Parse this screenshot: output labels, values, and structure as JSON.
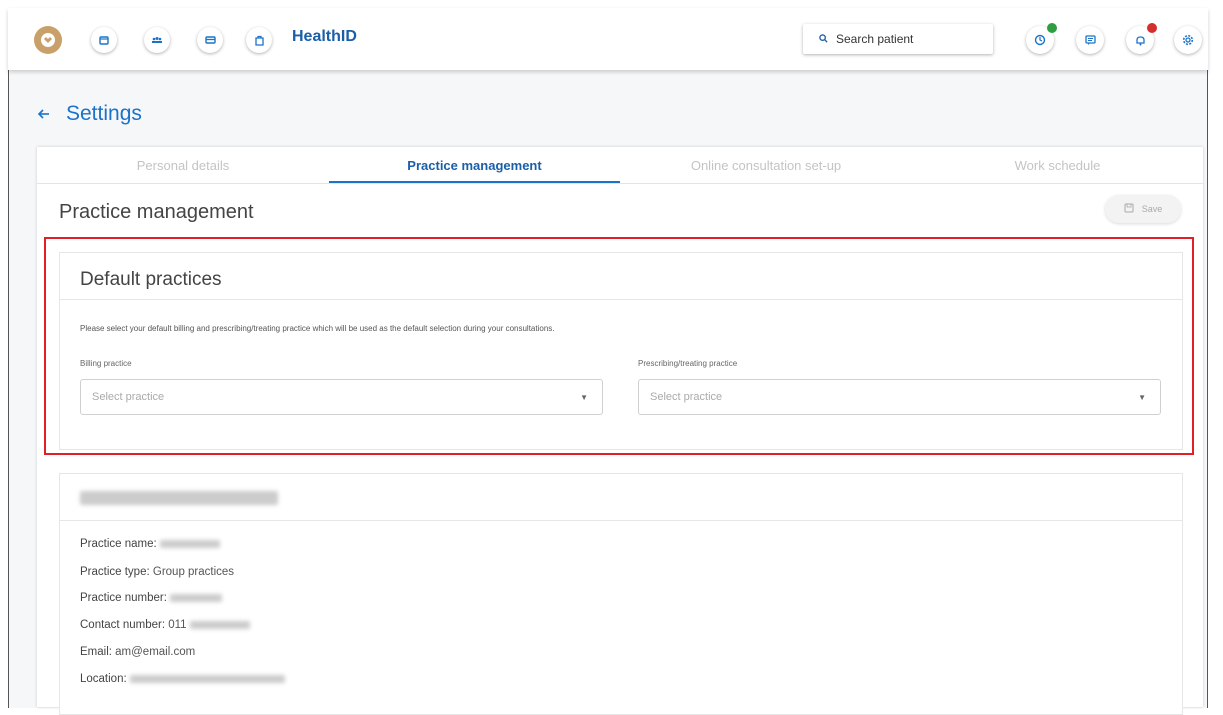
{
  "app": {
    "name": "HealthID"
  },
  "search": {
    "placeholder": "Search patient"
  },
  "page": {
    "title": "Settings"
  },
  "tabs": [
    {
      "label": "Personal details",
      "active": false
    },
    {
      "label": "Practice management",
      "active": true
    },
    {
      "label": "Online consultation set-up",
      "active": false
    },
    {
      "label": "Work schedule",
      "active": false
    }
  ],
  "section": {
    "title": "Practice management",
    "save_label": "Save"
  },
  "default_practices": {
    "title": "Default practices",
    "description": "Please select your default billing and prescribing/treating practice which will be used as the default selection during your consultations.",
    "billing_label": "Billing practice",
    "billing_placeholder": "Select practice",
    "prescribing_label": "Prescribing/treating practice",
    "prescribing_placeholder": "Select practice"
  },
  "practice_details": {
    "name_label": "Practice name:",
    "type_label": "Practice type:",
    "type_value": "Group practices",
    "number_label": "Practice number:",
    "contact_label": "Contact number:",
    "contact_value": "011",
    "email_label": "Email:",
    "email_value": "am@email.com",
    "location_label": "Location:"
  },
  "colors": {
    "accent": "#1a73c8",
    "highlight": "#e21f26",
    "status_green": "#2e9e3f",
    "status_red": "#d32f2f"
  },
  "icons": [
    "logo-icon",
    "calendar-icon",
    "patients-icon",
    "billing-icon",
    "clipboard-icon",
    "search-icon",
    "status-icon",
    "messages-icon",
    "notifications-icon",
    "settings-icon",
    "back-arrow-icon",
    "save-icon",
    "dropdown-arrow-icon"
  ]
}
